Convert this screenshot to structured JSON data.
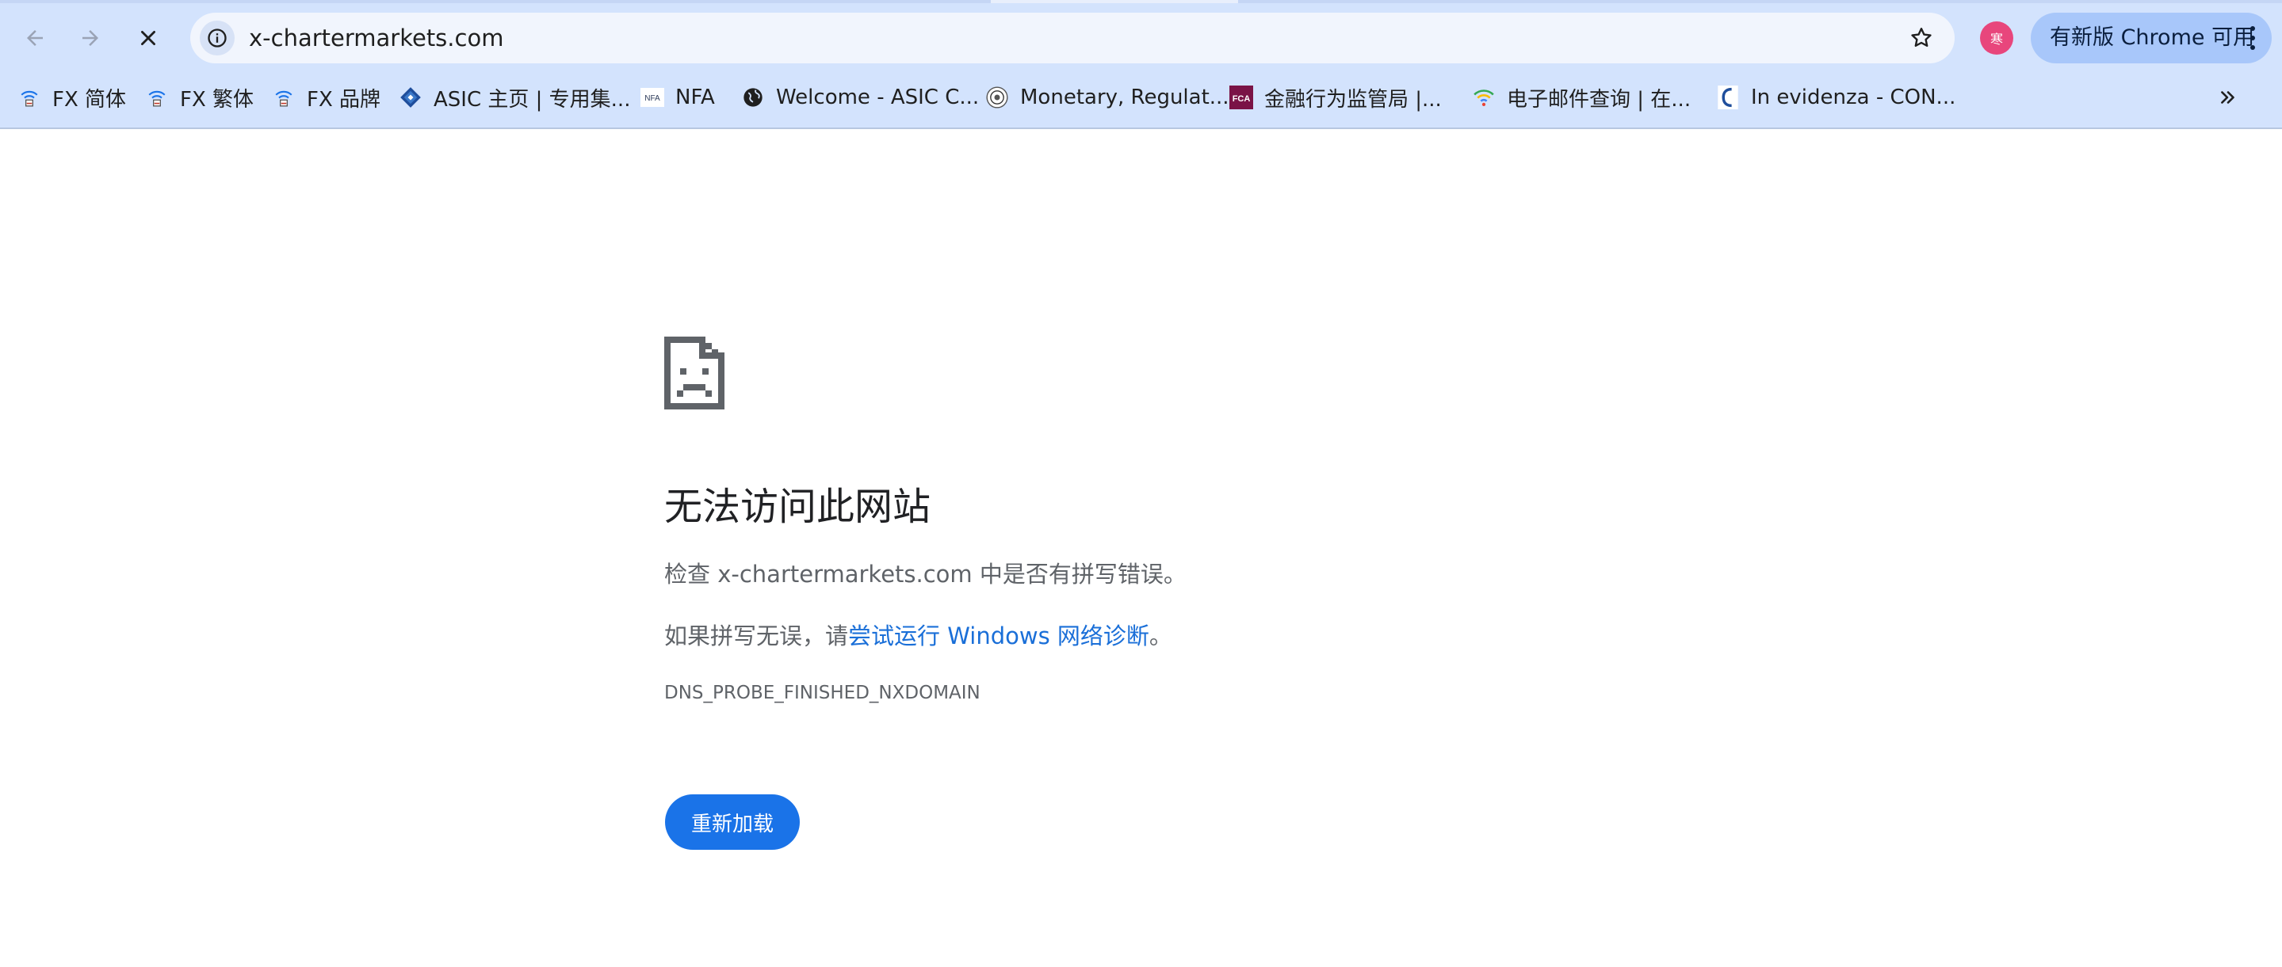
{
  "toolbar": {
    "url": "x-chartermarkets.com",
    "profile_initial": "寒",
    "update_label": "有新版 Chrome 可用"
  },
  "bookmarks": [
    {
      "label": "FX 简体",
      "icon": "fx-wifi-icon"
    },
    {
      "label": "FX 繁体",
      "icon": "fx-wifi-icon"
    },
    {
      "label": "FX 品牌",
      "icon": "fx-wifi-icon"
    },
    {
      "label": "ASIC 主页 | 专用集...",
      "icon": "asic-diamond-icon"
    },
    {
      "label": "NFA",
      "icon": "nfa-logo-icon"
    },
    {
      "label": "Welcome - ASIC C...",
      "icon": "globe-icon"
    },
    {
      "label": "Monetary, Regulat...",
      "icon": "seal-icon"
    },
    {
      "label": "金融行为监管局 |...",
      "icon": "fca-logo-icon"
    },
    {
      "label": "电子邮件查询 | 在...",
      "icon": "wifi-icon"
    },
    {
      "label": "In evidenza - CON...",
      "icon": "consob-logo-icon"
    }
  ],
  "page": {
    "title": "无法访问此网站",
    "line1": "检查 x-chartermarkets.com 中是否有拼写错误。",
    "line2_prefix": "如果拼写无误，请",
    "line2_link": "尝试运行 Windows 网络诊断",
    "line2_suffix": "。",
    "error_code": "DNS_PROBE_FINISHED_NXDOMAIN",
    "reload_label": "重新加载"
  },
  "colors": {
    "chrome_bg": "#d3e3fd",
    "omnibox_bg": "#f1f5fd",
    "update_btn_bg": "#a8c7fa",
    "profile_bg": "#e8467c",
    "link": "#1a6fd8",
    "primary_button": "#1a73e8"
  }
}
